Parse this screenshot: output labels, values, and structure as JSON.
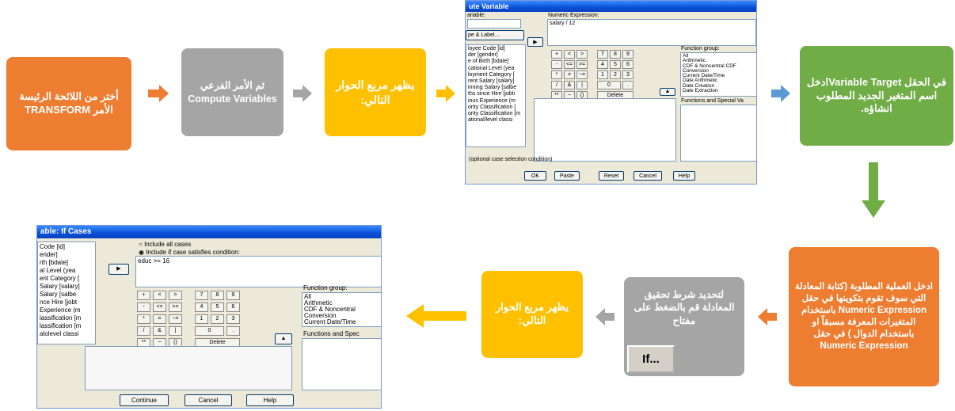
{
  "steps": {
    "step1": "أختر من اللائحة الرئيسة الأمر TRANSFORM",
    "step2": "ثم الأمر الفرعي Compute Variables",
    "step3": "يظهر مربع الحوار التالي:",
    "step4": "في الحقل Variable Targetادخل اسم المتغير الجديد المطلوب انشاؤه.",
    "step5": "ادخل العملية المطلوبة (كتابة المعادلة التي سوف تقوم بتكوينها في حقل Numeric Expression باستخدام المتغيرات المعرفة مسبقاً او باستخدام الدوال ) في حقل Numeric Expression",
    "step6": "لتحديد شرط تحقيق المعادلة قم بالضغط على مفتاح",
    "step6_button": "If...",
    "step7": "يظهر مربع الحوار التالي:"
  },
  "colors": {
    "orange": "#ed7d31",
    "gray": "#a5a5a5",
    "gold": "#ffc000",
    "green": "#70ad47",
    "blue": "#5b9bd5"
  },
  "compute_dialog": {
    "title": "ute Variable",
    "target_label": "ariable:",
    "numeric_label": "Numeric Expression:",
    "expression": "salary / 12",
    "type_label_button": "pe & Label...",
    "variables": [
      "loyee Code [id]",
      "der [gender]",
      "e of Birth [bdate]",
      "cational Level (yea",
      "loyment Category [",
      "rent Salary [salary]",
      "inning Salary [salbe",
      "ths since Hire [jobti",
      "ious Experience (m",
      "ority Classification [",
      "ority Classification [m",
      "ational/level classi"
    ],
    "keys": [
      "+",
      "<",
      ">",
      "7",
      "8",
      "9",
      "-",
      "<=",
      ">=",
      "4",
      "5",
      "6",
      "*",
      "=",
      "~=",
      "1",
      "2",
      "3",
      "/",
      "&",
      "|",
      "0",
      ".",
      "**",
      "~",
      "()",
      "Delete"
    ],
    "function_group_label": "Function group:",
    "function_groups": [
      "All",
      "Arithmetic",
      "CDF & Noncentral CDF",
      "Conversion",
      "Current Date/Time",
      "Date Arithmetic",
      "Date Creation",
      "Date Extraction"
    ],
    "functions_label": "Functions and Special Va",
    "condition_label": "(optional case selection condition)",
    "buttons": [
      "OK",
      "Paste",
      "Reset",
      "Cancel",
      "Help"
    ]
  },
  "if_dialog": {
    "title": "able: If Cases",
    "radio1": "Include all cases",
    "radio2": "Include if case satisfies condition:",
    "condition": "educ >= 16",
    "variables": [
      "Code [id]",
      "ender]",
      "rth [bdate]",
      "al Level (yea",
      "ent Category [",
      "Salary [salary]",
      "Salary [salbe",
      "nce Hire [jobt",
      "Experience (m",
      "lassification [m",
      "lassification [m",
      "alolevel classi"
    ],
    "keys": [
      "+",
      "<",
      ">",
      "7",
      "8",
      "9",
      "-",
      "<=",
      ">=",
      "4",
      "5",
      "6",
      "*",
      "=",
      "~=",
      "1",
      "2",
      "3",
      "/",
      "&",
      "|",
      "0",
      ".",
      "**",
      "~",
      "()",
      "Delete"
    ],
    "function_group_label": "Function group:",
    "function_groups": [
      "All",
      "Arithmetic",
      "CDF & Noncentral",
      "Conversion",
      "Current Date/Time"
    ],
    "functions_label": "Functions and Spec",
    "buttons": [
      "Continue",
      "Cancel",
      "Help"
    ]
  }
}
